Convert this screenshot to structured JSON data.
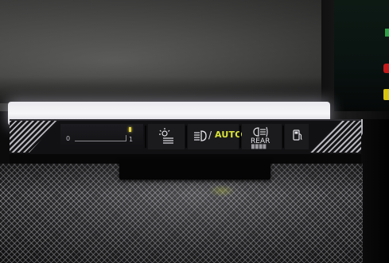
{
  "control_panel": {
    "dimmer": {
      "min_label": "0",
      "max_label": "1"
    },
    "headlight": {
      "separator": "/",
      "mode_label": "AUTO"
    },
    "fog": {
      "label": "REAR"
    }
  },
  "colors": {
    "auto_text": "#d9e23a",
    "indicator_yellow": "#e9d64a",
    "panel_bg": "#111113",
    "light_strip": "#f6f6f8"
  },
  "icons": [
    "daytime-running-light-icon",
    "headlight-icon",
    "rear-fog-light-icon",
    "fuel-door-icon"
  ]
}
